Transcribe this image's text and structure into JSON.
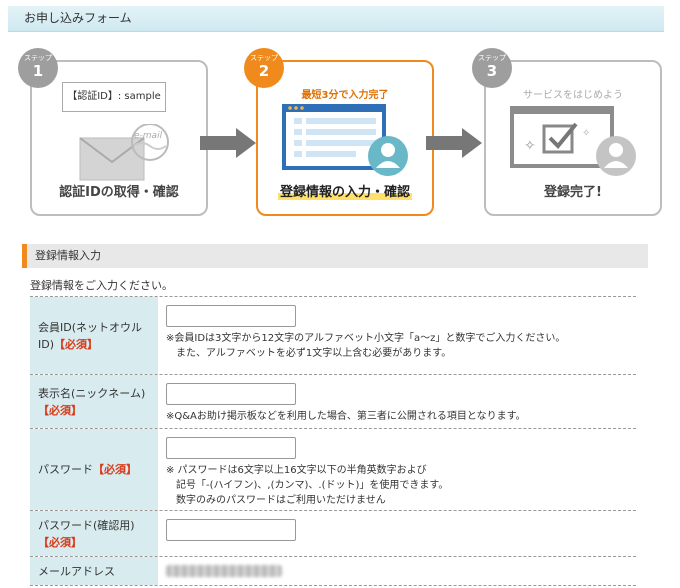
{
  "header": {
    "title": "お申し込みフォーム"
  },
  "steps": [
    {
      "badge_label": "ステップ",
      "number": "1",
      "subtitle": "",
      "card_text": "【認証ID】: sample",
      "envelope_text": "e-mail",
      "title": "認証IDの取得・確認"
    },
    {
      "badge_label": "ステップ",
      "number": "2",
      "subtitle": "最短3分で入力完了",
      "title": "登録情報の入力・確認"
    },
    {
      "badge_label": "ステップ",
      "number": "3",
      "subtitle": "サービスをはじめよう",
      "title": "登録完了!"
    }
  ],
  "section": {
    "title": "登録情報入力",
    "intro": "登録情報をご入力ください。"
  },
  "form": {
    "rows": [
      {
        "label": "会員ID(ネットオウル ID)",
        "required": "【必須】",
        "value": "",
        "note": "※会員IDは3文字から12文字のアルファベット小文字「a～z」と数字でご入力ください。\n　また、アルファベットを必ず1文字以上含む必要があります。"
      },
      {
        "label": "表示名(ニックネーム)",
        "required": "【必須】",
        "value": "",
        "note": "※Q&Aお助け掲示板などを利用した場合、第三者に公開される項目となります。"
      },
      {
        "label": "パスワード",
        "required": "【必須】",
        "value": "",
        "note": "※ パスワードは6文字以上16文字以下の半角英数字および\n　記号「-(ハイフン)、,(カンマ)、.(ドット)」を使用できます。\n　数字のみのパスワードはご利用いただけません"
      },
      {
        "label": "パスワード(確認用)",
        "required": "【必須】",
        "value": "",
        "note": ""
      },
      {
        "label": "メールアドレス",
        "required": "",
        "value": "",
        "note": ""
      }
    ]
  },
  "colors": {
    "accent": "#f08a1c",
    "label_bg": "#d8ecef",
    "required": "#d83a1a"
  }
}
